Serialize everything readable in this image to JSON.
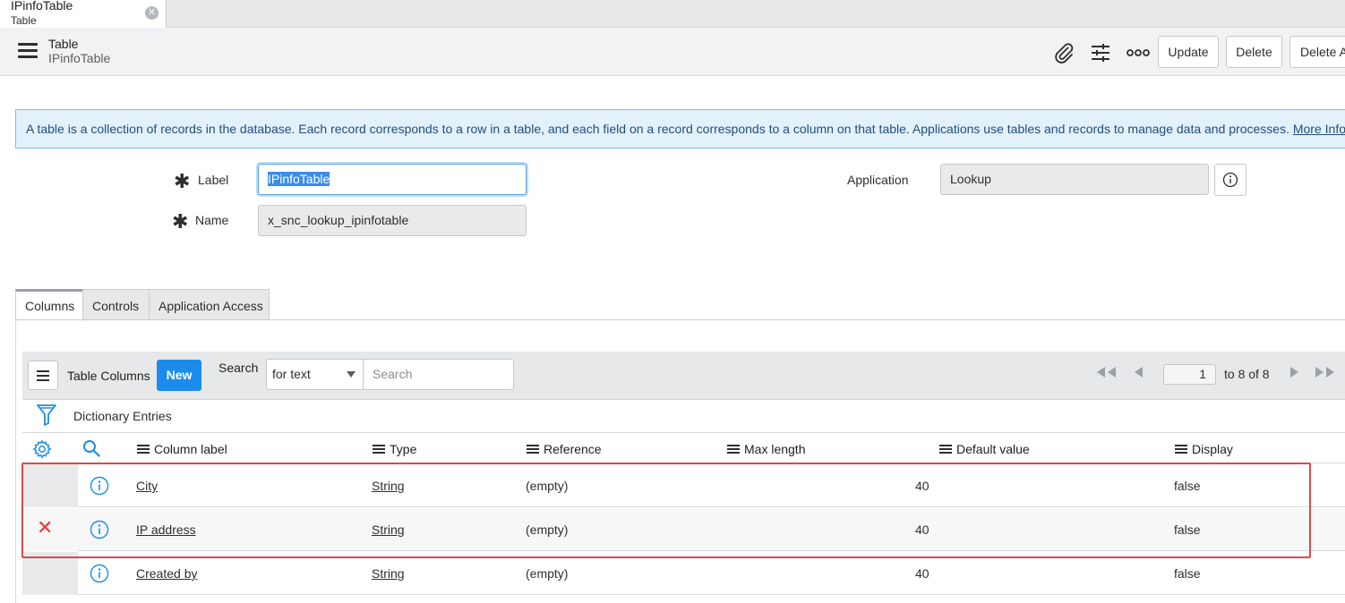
{
  "tab": {
    "title": "IPinfoTable",
    "subtitle": "Table",
    "close_icon": "close-icon"
  },
  "header": {
    "title": "Table",
    "subtitle": "IPinfoTable",
    "icons": [
      "paperclip-icon",
      "sliders-icon",
      "more-icon"
    ],
    "buttons": {
      "update": "Update",
      "delete": "Delete",
      "delete_all": "Delete A"
    }
  },
  "banner": {
    "text": "A table is a collection of records in the database. Each record corresponds to a row in a table, and each field on a record corresponds to a column on that table. Applications use tables and records to manage data and processes.",
    "link": "More Info"
  },
  "form": {
    "label_label": "Label",
    "label_value": "IPinfoTable",
    "name_label": "Name",
    "name_value": "x_snc_lookup_ipinfotable",
    "application_label": "Application",
    "application_value": "Lookup"
  },
  "section_tabs": [
    "Columns",
    "Controls",
    "Application Access"
  ],
  "list": {
    "title": "Table Columns",
    "new_button": "New",
    "search_label": "Search",
    "search_field": "for text",
    "search_placeholder": "Search",
    "page_value": "1",
    "page_of": "to 8 of 8",
    "breadcrumb": "Dictionary Entries",
    "columns": [
      "Column label",
      "Type",
      "Reference",
      "Max length",
      "Default value",
      "Display"
    ],
    "rows": [
      {
        "label": "City",
        "type": "String",
        "reference": "(empty)",
        "max_length": "40",
        "display": "false",
        "deletable": false
      },
      {
        "label": "IP address",
        "type": "String",
        "reference": "(empty)",
        "max_length": "40",
        "display": "false",
        "deletable": true
      },
      {
        "label": "Created by",
        "type": "String",
        "reference": "(empty)",
        "max_length": "40",
        "display": "false",
        "deletable": false
      }
    ]
  },
  "colors": {
    "accent": "#1b8ceb",
    "highlight": "#d94a4a",
    "delete": "#e33b3b",
    "banner_bg": "#e3f1fb"
  }
}
